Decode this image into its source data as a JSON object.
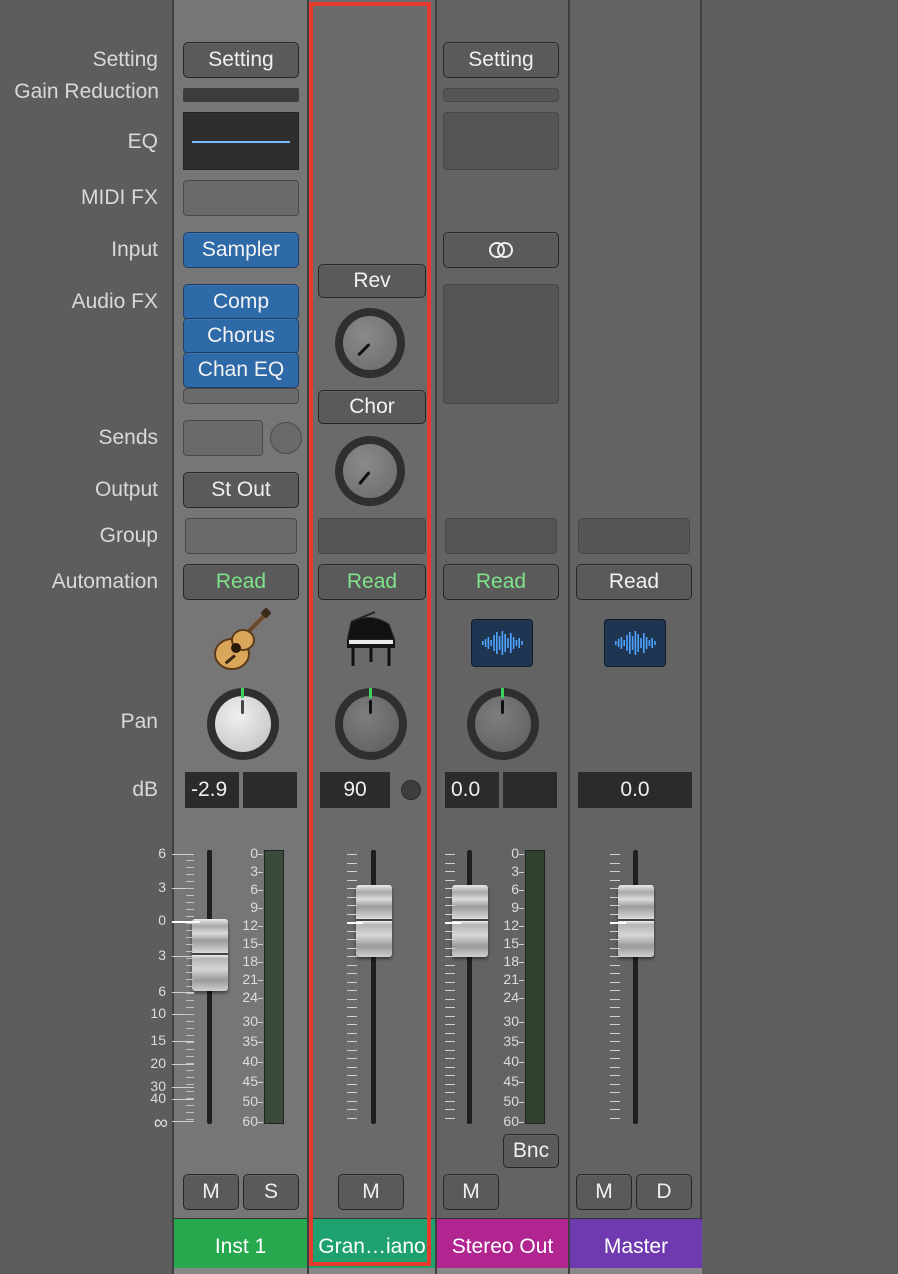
{
  "row_labels": {
    "setting": "Setting",
    "gain_reduction": "Gain Reduction",
    "eq": "EQ",
    "midi_fx": "MIDI FX",
    "input": "Input",
    "audio_fx": "Audio FX",
    "sends": "Sends",
    "output": "Output",
    "group": "Group",
    "automation": "Automation",
    "pan": "Pan",
    "db": "dB"
  },
  "colors": {
    "inst1": "#27a84f",
    "grand_piano": "#1ea06f",
    "stereo_out": "#b0258f",
    "master": "#6f3ab0",
    "selection": "#e53a2d",
    "plugin_blue": "#2f6aa8",
    "read_green": "#7fe38a"
  },
  "strips": {
    "inst1": {
      "setting": "Setting",
      "input": "Sampler",
      "audio_fx": [
        "Comp",
        "Chorus",
        "Chan EQ"
      ],
      "output": "St Out",
      "automation": "Read",
      "icon": "acoustic-guitar-icon",
      "db_value": "-2.9",
      "mute": "M",
      "solo": "S",
      "name": "Inst 1"
    },
    "grand_piano": {
      "sends": [
        "Rev",
        "Chor"
      ],
      "automation": "Read",
      "icon": "grand-piano-icon",
      "db_value": "90",
      "mute": "M",
      "name": "Gran…iano"
    },
    "stereo_out": {
      "setting": "Setting",
      "input_icon": "stereo-link-icon",
      "automation": "Read",
      "icon": "waveform-icon",
      "db_value": "0.0",
      "bounce": "Bnc",
      "mute": "M",
      "name": "Stereo Out"
    },
    "master": {
      "automation": "Read",
      "icon": "waveform-icon",
      "db_value": "0.0",
      "mute": "M",
      "dim": "D",
      "name": "Master"
    }
  },
  "scales": {
    "fader": [
      "6",
      "3",
      "0",
      "3",
      "6",
      "10",
      "15",
      "20",
      "30",
      "40",
      "∞"
    ],
    "meter": [
      "0",
      "3",
      "6",
      "9",
      "12",
      "15",
      "18",
      "21",
      "24",
      "30",
      "35",
      "40",
      "45",
      "50",
      "60"
    ]
  }
}
